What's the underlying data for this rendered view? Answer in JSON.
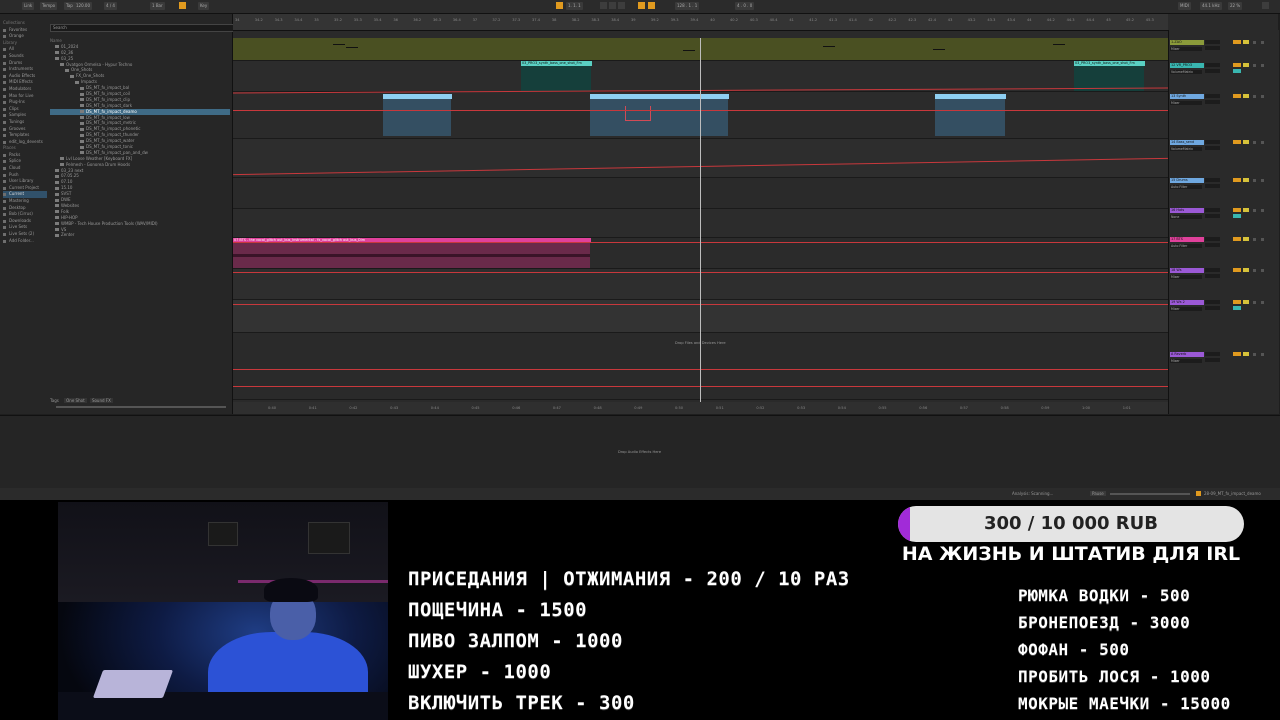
{
  "daw": {
    "topbar": {
      "segments": [
        "Link",
        "Tempo",
        "Tap",
        "120.00",
        "4 / 4",
        "1 Bar",
        "Key",
        "MIDI",
        "44.1 kHz",
        "22 %",
        "1. 1. 1",
        "128 . 1 . 1",
        "4 . 0 . 0"
      ]
    },
    "browser": {
      "search_placeholder": "Search",
      "places_header": "Collections",
      "collections": [
        "Favorites",
        "Orange"
      ],
      "library_header": "Library",
      "places": [
        "All",
        "Sounds",
        "Drums",
        "Instruments",
        "Audio Effects",
        "MIDI Effects",
        "Modulators",
        "Max for Live",
        "Plug-Ins",
        "Clips",
        "Samples",
        "Tunings",
        "Grooves",
        "Templates",
        "edit_log_devents"
      ],
      "places_header2": "Places",
      "places2": [
        "Packs",
        "Splice",
        "Cloud",
        "Push",
        "User Library",
        "Current Project",
        "Current",
        "Mastering",
        "Desktop",
        "Bob (Cirrus)",
        "Downloads",
        "Live Sets",
        "Live Sets (2)",
        "Add Folder..."
      ],
      "tree_header": "Name",
      "tree": [
        "01_2024",
        "02_36",
        "03_25",
        "Ovatgon Ormelsa - Hypur Techno",
        "One_Shots",
        "FX_One_Shots",
        "Impacts",
        "DS_MT_fx_impact_bal",
        "DS_MT_fx_impact_coil",
        "DS_MT_fx_impact_clip",
        "DS_MT_fx_impact_dark",
        "DS_MT_fx_impact_deamo",
        "DS_MT_fx_impact_low",
        "DS_MT_fx_impact_metric",
        "DS_MT_fx_impact_phonetic",
        "DS_MT_fx_impact_thunder",
        "DS_MT_fx_impact_water",
        "DS_MT_fx_impact_tonic",
        "DS_MT_fx_impact_pan_and_dw",
        "Lvl Loose Weather [Keyboard FX]",
        "Pelmesh - Gonorea Drum Hoods",
        "03_23 next",
        "07.05.25",
        "07.10",
        "15.10",
        "SVST",
        "DWE",
        "Websites",
        "Folk",
        "HIP-HOP",
        "WMBP - Tech House Production Tools (WAV/MIDI)",
        "VS",
        "Zenter"
      ],
      "footer_tags": [
        "Tags",
        "One Shot",
        "Sound FX"
      ]
    },
    "ruler_marks": [
      "34",
      "34.2",
      "34.3",
      "34.4",
      "35",
      "35.2",
      "35.3",
      "35.4",
      "36",
      "36.2",
      "36.3",
      "36.4",
      "37",
      "37.2",
      "37.3",
      "37.4",
      "38",
      "38.2",
      "38.3",
      "38.4",
      "39",
      "39.2",
      "39.3",
      "39.4",
      "40",
      "40.2",
      "40.3",
      "40.4",
      "41",
      "41.2",
      "41.3",
      "41.4",
      "42",
      "42.2",
      "42.3",
      "42.4",
      "43",
      "43.2",
      "43.3",
      "43.4",
      "44",
      "44.2",
      "44.3",
      "44.4",
      "45",
      "45.2",
      "45.3"
    ],
    "time_marks": [
      "0:40",
      "0:41",
      "0:42",
      "0:43",
      "0:44",
      "0:45",
      "0:46",
      "0:47",
      "0:48",
      "0:49",
      "0:50",
      "0:51",
      "0:52",
      "0:53",
      "0:54",
      "0:55",
      "0:56",
      "0:57",
      "0:58",
      "0:59",
      "1:00",
      "1:01"
    ],
    "clips": {
      "synth_a": "03_PRO3_synth_bass_one_shot_Fm",
      "synth_b": "03_PRO3_synth_bass_one_shot_Fm",
      "vocal": "07 BTS - the vocal_glitch out_bus_Instrumental - fx_vocal_glitch out_bus_Dim"
    },
    "drop_text": "Drop Files and Devices Here",
    "drop_text2": "Drop Audio Effects Here",
    "mixer_tracks": [
      {
        "name": "1-ZAO",
        "color": "#8a9a3a",
        "sel": "Mixer"
      },
      {
        "name": "12 VR_PRO3",
        "color": "#39b6b0",
        "sel": "VolumeMatrix"
      },
      {
        "name": "13 Synth",
        "color": "#6fa8e0",
        "sel": "Mixer"
      },
      {
        "name": "14 Bass_send",
        "color": "#6fa8e0",
        "sel": "VolumeMatrix"
      },
      {
        "name": "15 Drums",
        "color": "#6fa8e0",
        "sel": "Auto Filter"
      },
      {
        "name": "16 Hats",
        "color": "#9b59d6",
        "sel": "None"
      },
      {
        "name": "17 BTS",
        "color": "#e0419b",
        "sel": "Auto Filter"
      },
      {
        "name": "18 Ws",
        "color": "#9b59d6",
        "sel": "Mixer"
      },
      {
        "name": "19 Ws 2",
        "color": "#9b59d6",
        "sel": "Mixer"
      },
      {
        "name": "A Reverb",
        "color": "#9b59d6",
        "sel": "Mixer"
      }
    ],
    "status": {
      "left": "Analysis: Scanning...",
      "right": "28-09_MT_fx_impact_deamo",
      "pause": "Pause"
    }
  },
  "stream": {
    "donation": {
      "progress_text": "300 / 10 000 RUB",
      "progress_fraction": 0.03,
      "goal": "НА ЖИЗНЬ И ШТАТИВ ДЛЯ IRL"
    },
    "menu_left": [
      "ПРИСЕДАНИЯ | ОТЖИМАНИЯ - 200 / 10 РАЗ",
      "ПОЩЕЧИНА - 1500",
      "ПИВО ЗАЛПОМ - 1000",
      "ШУХЕР - 1000",
      "ВКЛЮЧИТЬ ТРЕК - 300"
    ],
    "menu_right": [
      "РЮМКА ВОДКИ - 500",
      "БРОНЕПОЕЗД - 3000",
      "ФОФАН - 500",
      "ПРОБИТЬ ЛОСЯ - 1000",
      "МОКРЫЕ МАЕЧКИ - 15000"
    ]
  }
}
